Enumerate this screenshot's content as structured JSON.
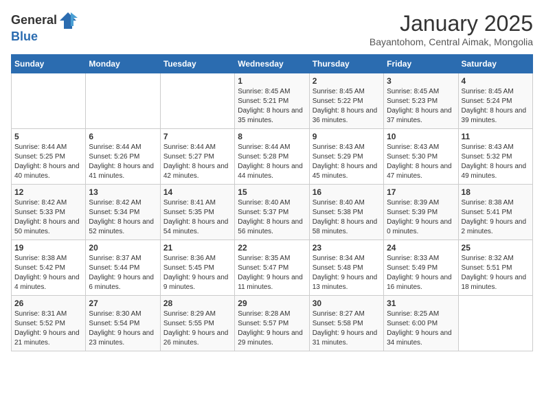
{
  "header": {
    "logo_general": "General",
    "logo_blue": "Blue",
    "month_year": "January 2025",
    "location": "Bayantohom, Central Aimak, Mongolia"
  },
  "days_of_week": [
    "Sunday",
    "Monday",
    "Tuesday",
    "Wednesday",
    "Thursday",
    "Friday",
    "Saturday"
  ],
  "weeks": [
    [
      {
        "day": "",
        "info": ""
      },
      {
        "day": "",
        "info": ""
      },
      {
        "day": "",
        "info": ""
      },
      {
        "day": "1",
        "info": "Sunrise: 8:45 AM\nSunset: 5:21 PM\nDaylight: 8 hours and 35 minutes."
      },
      {
        "day": "2",
        "info": "Sunrise: 8:45 AM\nSunset: 5:22 PM\nDaylight: 8 hours and 36 minutes."
      },
      {
        "day": "3",
        "info": "Sunrise: 8:45 AM\nSunset: 5:23 PM\nDaylight: 8 hours and 37 minutes."
      },
      {
        "day": "4",
        "info": "Sunrise: 8:45 AM\nSunset: 5:24 PM\nDaylight: 8 hours and 39 minutes."
      }
    ],
    [
      {
        "day": "5",
        "info": "Sunrise: 8:44 AM\nSunset: 5:25 PM\nDaylight: 8 hours and 40 minutes."
      },
      {
        "day": "6",
        "info": "Sunrise: 8:44 AM\nSunset: 5:26 PM\nDaylight: 8 hours and 41 minutes."
      },
      {
        "day": "7",
        "info": "Sunrise: 8:44 AM\nSunset: 5:27 PM\nDaylight: 8 hours and 42 minutes."
      },
      {
        "day": "8",
        "info": "Sunrise: 8:44 AM\nSunset: 5:28 PM\nDaylight: 8 hours and 44 minutes."
      },
      {
        "day": "9",
        "info": "Sunrise: 8:43 AM\nSunset: 5:29 PM\nDaylight: 8 hours and 45 minutes."
      },
      {
        "day": "10",
        "info": "Sunrise: 8:43 AM\nSunset: 5:30 PM\nDaylight: 8 hours and 47 minutes."
      },
      {
        "day": "11",
        "info": "Sunrise: 8:43 AM\nSunset: 5:32 PM\nDaylight: 8 hours and 49 minutes."
      }
    ],
    [
      {
        "day": "12",
        "info": "Sunrise: 8:42 AM\nSunset: 5:33 PM\nDaylight: 8 hours and 50 minutes."
      },
      {
        "day": "13",
        "info": "Sunrise: 8:42 AM\nSunset: 5:34 PM\nDaylight: 8 hours and 52 minutes."
      },
      {
        "day": "14",
        "info": "Sunrise: 8:41 AM\nSunset: 5:35 PM\nDaylight: 8 hours and 54 minutes."
      },
      {
        "day": "15",
        "info": "Sunrise: 8:40 AM\nSunset: 5:37 PM\nDaylight: 8 hours and 56 minutes."
      },
      {
        "day": "16",
        "info": "Sunrise: 8:40 AM\nSunset: 5:38 PM\nDaylight: 8 hours and 58 minutes."
      },
      {
        "day": "17",
        "info": "Sunrise: 8:39 AM\nSunset: 5:39 PM\nDaylight: 9 hours and 0 minutes."
      },
      {
        "day": "18",
        "info": "Sunrise: 8:38 AM\nSunset: 5:41 PM\nDaylight: 9 hours and 2 minutes."
      }
    ],
    [
      {
        "day": "19",
        "info": "Sunrise: 8:38 AM\nSunset: 5:42 PM\nDaylight: 9 hours and 4 minutes."
      },
      {
        "day": "20",
        "info": "Sunrise: 8:37 AM\nSunset: 5:44 PM\nDaylight: 9 hours and 6 minutes."
      },
      {
        "day": "21",
        "info": "Sunrise: 8:36 AM\nSunset: 5:45 PM\nDaylight: 9 hours and 9 minutes."
      },
      {
        "day": "22",
        "info": "Sunrise: 8:35 AM\nSunset: 5:47 PM\nDaylight: 9 hours and 11 minutes."
      },
      {
        "day": "23",
        "info": "Sunrise: 8:34 AM\nSunset: 5:48 PM\nDaylight: 9 hours and 13 minutes."
      },
      {
        "day": "24",
        "info": "Sunrise: 8:33 AM\nSunset: 5:49 PM\nDaylight: 9 hours and 16 minutes."
      },
      {
        "day": "25",
        "info": "Sunrise: 8:32 AM\nSunset: 5:51 PM\nDaylight: 9 hours and 18 minutes."
      }
    ],
    [
      {
        "day": "26",
        "info": "Sunrise: 8:31 AM\nSunset: 5:52 PM\nDaylight: 9 hours and 21 minutes."
      },
      {
        "day": "27",
        "info": "Sunrise: 8:30 AM\nSunset: 5:54 PM\nDaylight: 9 hours and 23 minutes."
      },
      {
        "day": "28",
        "info": "Sunrise: 8:29 AM\nSunset: 5:55 PM\nDaylight: 9 hours and 26 minutes."
      },
      {
        "day": "29",
        "info": "Sunrise: 8:28 AM\nSunset: 5:57 PM\nDaylight: 9 hours and 29 minutes."
      },
      {
        "day": "30",
        "info": "Sunrise: 8:27 AM\nSunset: 5:58 PM\nDaylight: 9 hours and 31 minutes."
      },
      {
        "day": "31",
        "info": "Sunrise: 8:25 AM\nSunset: 6:00 PM\nDaylight: 9 hours and 34 minutes."
      },
      {
        "day": "",
        "info": ""
      }
    ]
  ]
}
